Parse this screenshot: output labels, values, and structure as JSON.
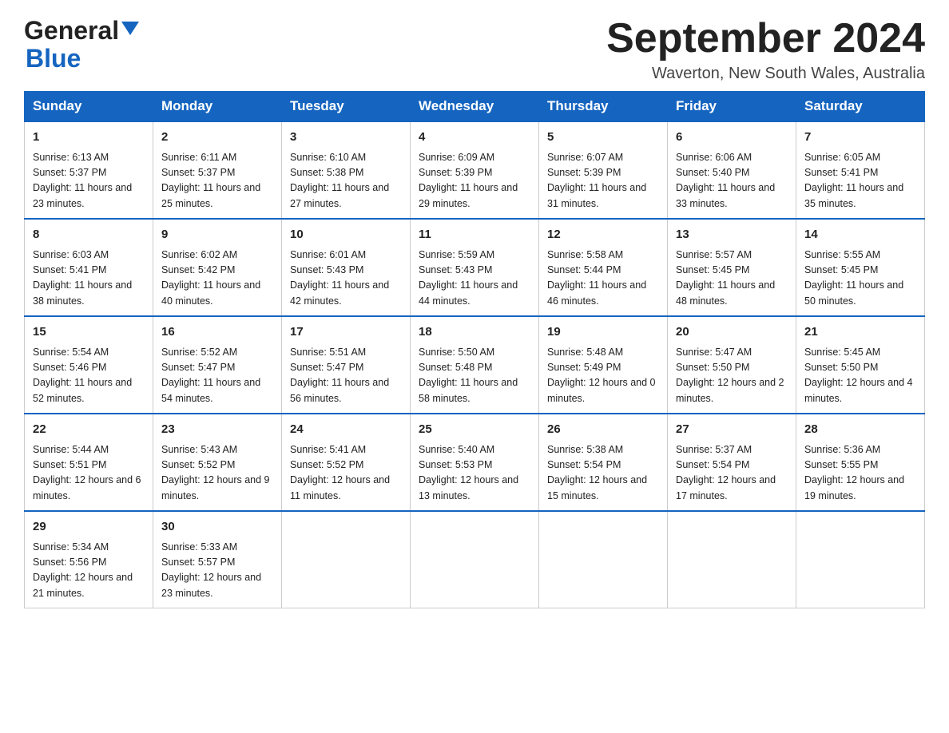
{
  "header": {
    "logo_general": "General",
    "logo_blue": "Blue",
    "month_title": "September 2024",
    "location": "Waverton, New South Wales, Australia"
  },
  "days_of_week": [
    "Sunday",
    "Monday",
    "Tuesday",
    "Wednesday",
    "Thursday",
    "Friday",
    "Saturday"
  ],
  "weeks": [
    [
      {
        "day": "1",
        "sunrise": "6:13 AM",
        "sunset": "5:37 PM",
        "daylight": "11 hours and 23 minutes."
      },
      {
        "day": "2",
        "sunrise": "6:11 AM",
        "sunset": "5:37 PM",
        "daylight": "11 hours and 25 minutes."
      },
      {
        "day": "3",
        "sunrise": "6:10 AM",
        "sunset": "5:38 PM",
        "daylight": "11 hours and 27 minutes."
      },
      {
        "day": "4",
        "sunrise": "6:09 AM",
        "sunset": "5:39 PM",
        "daylight": "11 hours and 29 minutes."
      },
      {
        "day": "5",
        "sunrise": "6:07 AM",
        "sunset": "5:39 PM",
        "daylight": "11 hours and 31 minutes."
      },
      {
        "day": "6",
        "sunrise": "6:06 AM",
        "sunset": "5:40 PM",
        "daylight": "11 hours and 33 minutes."
      },
      {
        "day": "7",
        "sunrise": "6:05 AM",
        "sunset": "5:41 PM",
        "daylight": "11 hours and 35 minutes."
      }
    ],
    [
      {
        "day": "8",
        "sunrise": "6:03 AM",
        "sunset": "5:41 PM",
        "daylight": "11 hours and 38 minutes."
      },
      {
        "day": "9",
        "sunrise": "6:02 AM",
        "sunset": "5:42 PM",
        "daylight": "11 hours and 40 minutes."
      },
      {
        "day": "10",
        "sunrise": "6:01 AM",
        "sunset": "5:43 PM",
        "daylight": "11 hours and 42 minutes."
      },
      {
        "day": "11",
        "sunrise": "5:59 AM",
        "sunset": "5:43 PM",
        "daylight": "11 hours and 44 minutes."
      },
      {
        "day": "12",
        "sunrise": "5:58 AM",
        "sunset": "5:44 PM",
        "daylight": "11 hours and 46 minutes."
      },
      {
        "day": "13",
        "sunrise": "5:57 AM",
        "sunset": "5:45 PM",
        "daylight": "11 hours and 48 minutes."
      },
      {
        "day": "14",
        "sunrise": "5:55 AM",
        "sunset": "5:45 PM",
        "daylight": "11 hours and 50 minutes."
      }
    ],
    [
      {
        "day": "15",
        "sunrise": "5:54 AM",
        "sunset": "5:46 PM",
        "daylight": "11 hours and 52 minutes."
      },
      {
        "day": "16",
        "sunrise": "5:52 AM",
        "sunset": "5:47 PM",
        "daylight": "11 hours and 54 minutes."
      },
      {
        "day": "17",
        "sunrise": "5:51 AM",
        "sunset": "5:47 PM",
        "daylight": "11 hours and 56 minutes."
      },
      {
        "day": "18",
        "sunrise": "5:50 AM",
        "sunset": "5:48 PM",
        "daylight": "11 hours and 58 minutes."
      },
      {
        "day": "19",
        "sunrise": "5:48 AM",
        "sunset": "5:49 PM",
        "daylight": "12 hours and 0 minutes."
      },
      {
        "day": "20",
        "sunrise": "5:47 AM",
        "sunset": "5:50 PM",
        "daylight": "12 hours and 2 minutes."
      },
      {
        "day": "21",
        "sunrise": "5:45 AM",
        "sunset": "5:50 PM",
        "daylight": "12 hours and 4 minutes."
      }
    ],
    [
      {
        "day": "22",
        "sunrise": "5:44 AM",
        "sunset": "5:51 PM",
        "daylight": "12 hours and 6 minutes."
      },
      {
        "day": "23",
        "sunrise": "5:43 AM",
        "sunset": "5:52 PM",
        "daylight": "12 hours and 9 minutes."
      },
      {
        "day": "24",
        "sunrise": "5:41 AM",
        "sunset": "5:52 PM",
        "daylight": "12 hours and 11 minutes."
      },
      {
        "day": "25",
        "sunrise": "5:40 AM",
        "sunset": "5:53 PM",
        "daylight": "12 hours and 13 minutes."
      },
      {
        "day": "26",
        "sunrise": "5:38 AM",
        "sunset": "5:54 PM",
        "daylight": "12 hours and 15 minutes."
      },
      {
        "day": "27",
        "sunrise": "5:37 AM",
        "sunset": "5:54 PM",
        "daylight": "12 hours and 17 minutes."
      },
      {
        "day": "28",
        "sunrise": "5:36 AM",
        "sunset": "5:55 PM",
        "daylight": "12 hours and 19 minutes."
      }
    ],
    [
      {
        "day": "29",
        "sunrise": "5:34 AM",
        "sunset": "5:56 PM",
        "daylight": "12 hours and 21 minutes."
      },
      {
        "day": "30",
        "sunrise": "5:33 AM",
        "sunset": "5:57 PM",
        "daylight": "12 hours and 23 minutes."
      },
      null,
      null,
      null,
      null,
      null
    ]
  ],
  "labels": {
    "sunrise": "Sunrise:",
    "sunset": "Sunset:",
    "daylight": "Daylight:"
  }
}
